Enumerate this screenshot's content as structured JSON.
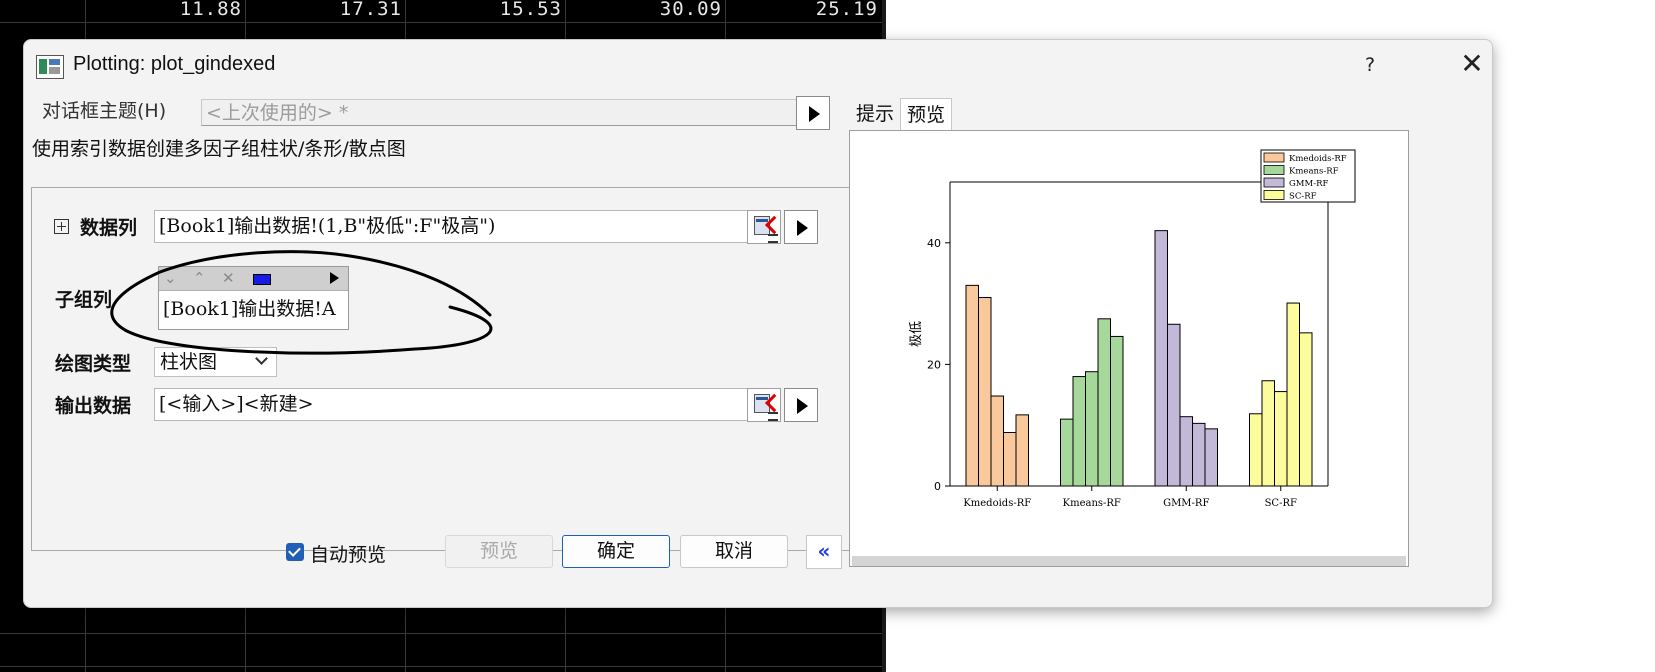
{
  "sheet": {
    "values": [
      "11.88",
      "17.31",
      "15.53",
      "30.09",
      "25.19"
    ]
  },
  "dialog": {
    "title": "Plotting: plot_gindexed",
    "help_label": "?",
    "close_label": "✕",
    "theme_label": "对话框主题(H)",
    "theme_value": "<上次使用的> *",
    "description": "使用索引数据创建多因子组柱状/条形/散点图",
    "data_col_label": "数据列",
    "data_col_value": "[Book1]输出数据!(1,B\"极低\":F\"极高\")",
    "subgroup_label": "子组列",
    "subgroup_value": "[Book1]输出数据!A",
    "subgroup_toolbar_icons": [
      "down-icon",
      "up-icon",
      "delete-icon",
      "blue-rect-icon",
      "play-icon"
    ],
    "plottype_label": "绘图类型",
    "plottype_value": "柱状图",
    "output_label": "输出数据",
    "output_value": "[<输入>]<新建>",
    "auto_preview_label": "自动预览",
    "auto_preview_checked": true,
    "preview_btn": "预览",
    "ok_btn": "确定",
    "cancel_btn": "取消",
    "collapse_btn": "«",
    "tabs": [
      "提示",
      "预览"
    ],
    "active_tab": "预览"
  },
  "chart_data": {
    "type": "bar",
    "ylabel": "极低",
    "ylim": [
      0,
      50
    ],
    "yticks": [
      0,
      20,
      40
    ],
    "categories": [
      "Kmedoids-RF",
      "Kmeans-RF",
      "GMM-RF",
      "SC-RF"
    ],
    "legend": [
      {
        "name": "Kmedoids-RF",
        "color": "#F9C89B"
      },
      {
        "name": "Kmeans-RF",
        "color": "#A6D89B"
      },
      {
        "name": "GMM-RF",
        "color": "#C2B8D8"
      },
      {
        "name": "SC-RF",
        "color": "#FCFC9C"
      }
    ],
    "groups": [
      [
        33,
        31,
        14.8,
        8.8,
        11.7
      ],
      [
        11,
        18,
        18.8,
        27.5,
        24.6
      ],
      [
        42,
        26.6,
        11.4,
        10.3,
        9.4
      ],
      [
        11.88,
        17.31,
        15.53,
        30.09,
        25.19
      ]
    ]
  }
}
